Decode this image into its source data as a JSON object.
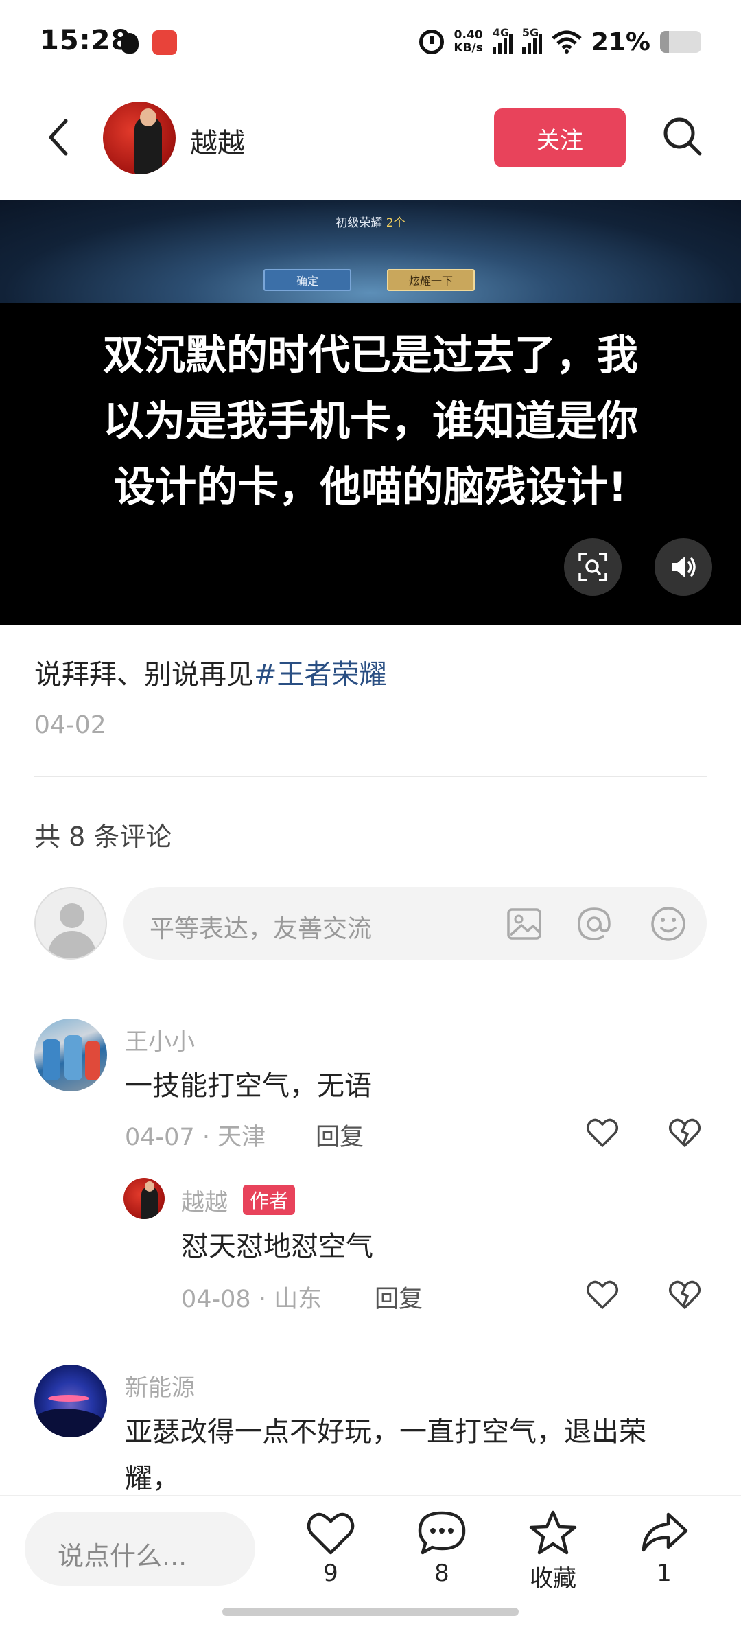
{
  "status_bar": {
    "time": "15:28",
    "net_speed_value": "0.40",
    "net_speed_unit": "KB/s",
    "signal_1_label": "4G",
    "signal_2_label": "5G",
    "battery_pct": "21%",
    "battery_level": 0.21,
    "icons": [
      "qq-icon",
      "app-notification-icon",
      "alarm-icon",
      "signal-4g-icon",
      "signal-5g-icon",
      "wifi-icon",
      "battery-icon"
    ]
  },
  "header": {
    "author_name": "越越",
    "follow_label": "关注"
  },
  "video": {
    "game_title": "初级荣耀",
    "game_title_count": "2个",
    "game_btn_confirm": "确定",
    "game_btn_show": "炫耀一下",
    "caption": "双沉默的时代已是过去了，我以为是我手机卡，谁知道是你设计的卡，他喵的脑残设计!"
  },
  "post": {
    "text": "说拜拜、别说再见",
    "hashtag": "#王者荣耀",
    "date": "04-02"
  },
  "comments_header": {
    "count_label": "共 8 条评论"
  },
  "comment_input": {
    "placeholder": "平等表达，友善交流"
  },
  "comments": [
    {
      "user": "王小小",
      "text": "一技能打空气，无语",
      "meta": "04-07 · 天津",
      "reply_label": "回复"
    },
    {
      "user": "越越",
      "badge": "作者",
      "text": "怼天怼地怼空气",
      "meta": "04-08 · 山东",
      "reply_label": "回复"
    },
    {
      "user": "新能源",
      "text": "亚瑟改得一点不好玩，一直打空气，退出荣耀，"
    }
  ],
  "bottom_bar": {
    "say_placeholder": "说点什么...",
    "like_count": "9",
    "comment_count": "8",
    "favorite_label": "收藏",
    "share_count": "1"
  },
  "colors": {
    "accent": "#e8435b",
    "hashtag": "#2a4f83"
  }
}
